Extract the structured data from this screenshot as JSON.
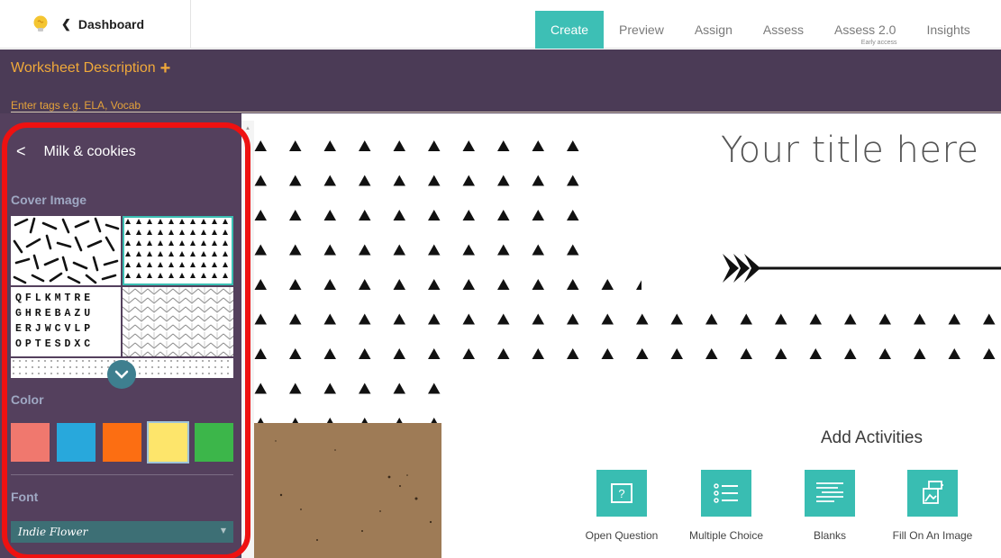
{
  "topbar": {
    "back_label": "Dashboard",
    "tabs": [
      {
        "label": "Create",
        "active": true
      },
      {
        "label": "Preview"
      },
      {
        "label": "Assign"
      },
      {
        "label": "Assess"
      },
      {
        "label": "Assess 2.0",
        "sub": "Early access"
      },
      {
        "label": "Insights"
      }
    ]
  },
  "header": {
    "description_label": "Worksheet Description",
    "tags_placeholder": "Enter tags e.g. ELA, Vocab"
  },
  "panel": {
    "title": "Milk & cookies",
    "cover_label": "Cover Image",
    "color_label": "Color",
    "font_label": "Font",
    "font_value": "Indie Flower",
    "wordsearch": [
      "QFLKMTRE",
      "GHREBAZU",
      "ERJWCVLP",
      "OPTESDXC"
    ],
    "colors": [
      "#f0786e",
      "#28a8dc",
      "#fc6e12",
      "#fde56b",
      "#3cb64a"
    ],
    "selected_color_index": 3
  },
  "canvas": {
    "title": "Your title here"
  },
  "activities": {
    "heading": "Add Activities",
    "items": [
      {
        "label": "Open Question",
        "icon": "question-icon"
      },
      {
        "label": "Multiple Choice",
        "icon": "list-icon"
      },
      {
        "label": "Blanks",
        "icon": "blanks-icon"
      },
      {
        "label": "Fill On An Image",
        "icon": "image-fill-icon"
      }
    ]
  }
}
